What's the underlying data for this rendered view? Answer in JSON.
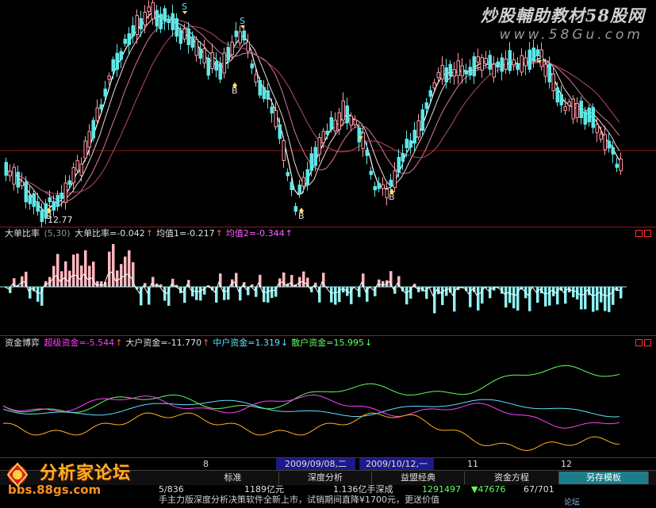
{
  "watermark": {
    "title": "炒股輔助教材58股网",
    "url": "www.58Gu.com"
  },
  "main": {
    "low_label": "12.77",
    "signals": [
      "S",
      "S",
      "S",
      "S",
      "B",
      "B",
      "B",
      "B"
    ],
    "colors": {
      "up": "#ff9aa6",
      "down": "#5fe6e6",
      "ma1": "#ffffff",
      "ma2": "#f0d8d8",
      "ma3": "#d8789a",
      "ma4": "#b44a6e"
    }
  },
  "osc": {
    "title": "大单比率",
    "params": "(5,30)",
    "v1": "大单比率=-0.042",
    "v2": "均值1=-0.217",
    "v3": "均值2=-0.344",
    "arrow_up": "↑"
  },
  "flow": {
    "title": "资金博弈",
    "super": "超级资金=-5.544",
    "big": "大户资金=-11.770",
    "mid": "中户资金=1.319",
    "retail": "散户资金=15.995",
    "arrow_up": "↑",
    "arrow_down": "↓",
    "colors": {
      "super": "#ff40ff",
      "big": "#ffd0d0",
      "mid": "#60e0ff",
      "retail": "#60ff60"
    }
  },
  "xaxis": {
    "labels": [
      "8",
      "2009/09/08,二",
      "2009/10/12,一",
      "11",
      "12"
    ]
  },
  "tabs": {
    "items": [
      "标准",
      "深度分析",
      "益盟经典",
      "资金方程",
      "另存模板"
    ],
    "active_index": 4
  },
  "ticker": {
    "a": "5/836",
    "b": "1189亿元",
    "c": "1.136亿手深成",
    "d": "1291497",
    "e": "▼47676",
    "f": "67/701"
  },
  "news": {
    "text": "手主力版深度分析决策软件全新上市，试销期间直降¥1700元，更送价值"
  },
  "logo": {
    "name": "分析家论坛",
    "url": "bbs.88gs.com"
  },
  "corner": {
    "text": "论坛"
  }
}
